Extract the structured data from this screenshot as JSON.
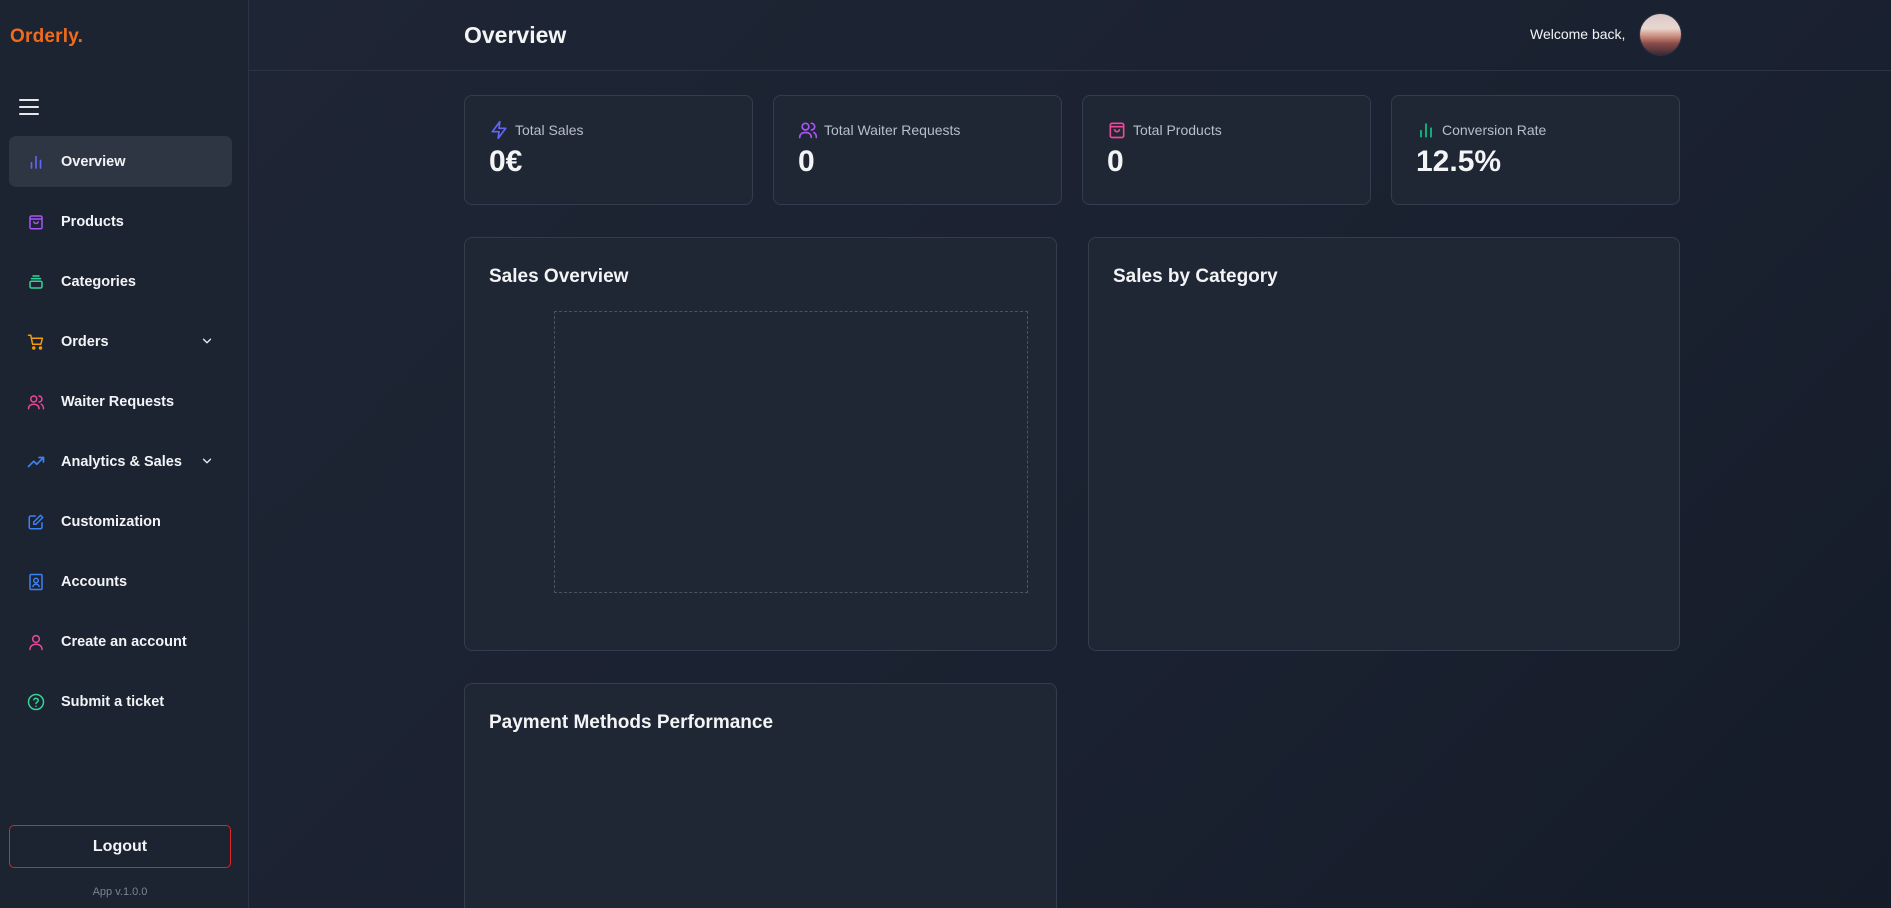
{
  "brand": {
    "logo": "Orderly."
  },
  "sidebar": {
    "items": [
      {
        "label": "Overview",
        "icon": "bar-chart-icon",
        "color": "#6366f1",
        "active": true
      },
      {
        "label": "Products",
        "icon": "shopping-bag-icon",
        "color": "#a855f7"
      },
      {
        "label": "Categories",
        "icon": "layers-icon",
        "color": "#34d399"
      },
      {
        "label": "Orders",
        "icon": "cart-icon",
        "color": "#f59e0b",
        "expandable": true
      },
      {
        "label": "Waiter Requests",
        "icon": "users-icon",
        "color": "#ec4899"
      },
      {
        "label": "Analytics & Sales",
        "icon": "trending-up-icon",
        "color": "#3b82f6",
        "expandable": true
      },
      {
        "label": "Customization",
        "icon": "edit-icon",
        "color": "#3b82f6"
      },
      {
        "label": "Accounts",
        "icon": "contact-book-icon",
        "color": "#3b82f6"
      },
      {
        "label": "Create an account",
        "icon": "user-icon",
        "color": "#ec4899"
      },
      {
        "label": "Submit a ticket",
        "icon": "help-circle-icon",
        "color": "#34d399"
      }
    ],
    "logout_label": "Logout",
    "version": "App v.1.0.0"
  },
  "header": {
    "title": "Overview",
    "welcome": "Welcome back,"
  },
  "stats": [
    {
      "title": "Total Sales",
      "value": "0€",
      "icon": "zap-icon",
      "color": "#6366f1"
    },
    {
      "title": "Total Waiter Requests",
      "value": "0",
      "icon": "users-icon",
      "color": "#a855f7"
    },
    {
      "title": "Total Products",
      "value": "0",
      "icon": "shopping-bag-icon",
      "color": "#ec4899"
    },
    {
      "title": "Conversion Rate",
      "value": "12.5%",
      "icon": "bar-chart-icon",
      "color": "#10b981"
    }
  ],
  "panels": {
    "sales_overview": "Sales Overview",
    "sales_by_category": "Sales by Category",
    "payment_methods": "Payment Methods Performance"
  }
}
